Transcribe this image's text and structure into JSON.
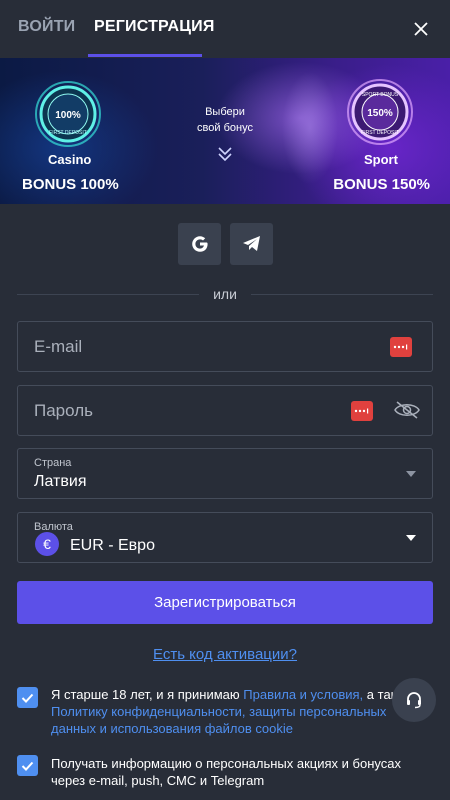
{
  "header": {
    "login_tab": "ВОЙТИ",
    "register_tab": "РЕГИСТРАЦИЯ"
  },
  "banner": {
    "casino": {
      "medal_text": "100%",
      "medal_subtext": "FIRST DEPOSIT",
      "label": "Casino",
      "bonus": "BONUS 100%"
    },
    "sport": {
      "medal_text": "150%",
      "medal_top_text": "SPORT BONUS",
      "medal_subtext": "FIRST DEPOSIT",
      "label": "Sport",
      "bonus": "BONUS 150%"
    },
    "choose_line1": "Выбери",
    "choose_line2": "свой бонус"
  },
  "social": {
    "google_icon": "google-icon",
    "telegram_icon": "telegram-icon"
  },
  "divider": {
    "text": "или"
  },
  "form": {
    "email_placeholder": "E-mail",
    "password_placeholder": "Пароль",
    "country_label": "Страна",
    "country_value": "Латвия",
    "currency_label": "Валюта",
    "currency_symbol": "€",
    "currency_value": "EUR - Евро",
    "register_button": "Зарегистрироваться",
    "activation_link": "Есть код активации?"
  },
  "consent": {
    "age_text_before": "Я старше 18 лет, и я принимаю ",
    "age_link_terms": "Правила и условия,",
    "age_text_mid": " а также ",
    "age_link_privacy": "Политику конфиденциальности, защиты персональных данных и использования файлов cookie",
    "marketing_text": "Получать информацию о персональных акциях и бонусах через e-mail, push, СМС и Telegram"
  },
  "colors": {
    "background": "#282d38",
    "accent": "#5c50e8",
    "link": "#4f8ff0",
    "field_border": "#454c5a"
  }
}
